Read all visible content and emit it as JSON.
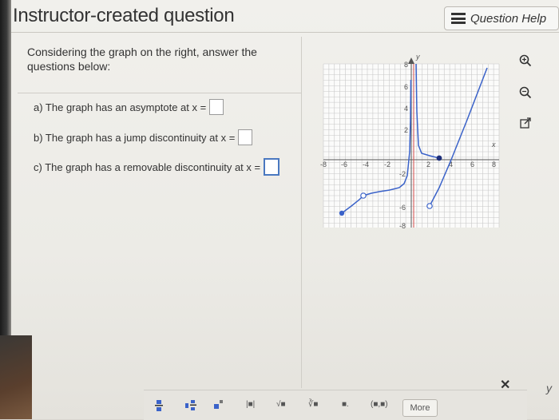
{
  "header": {
    "title": "Instructor-created question",
    "help_label": "Question Help"
  },
  "question": {
    "prompt": "Considering the graph on the right, answer the questions below:",
    "items": [
      {
        "label": "a) The graph has an asymptote at x ="
      },
      {
        "label": "b) The graph has a jump discontinuity at x ="
      },
      {
        "label": "c) The graph has a removable discontinuity at x ="
      }
    ]
  },
  "graph": {
    "axis_x_label": "x",
    "axis_y_label": "y",
    "x_ticks": [
      "-8",
      "-6",
      "-4",
      "-2",
      "2",
      "4",
      "6",
      "8"
    ],
    "y_ticks": [
      "8",
      "6",
      "4",
      "2",
      "-2",
      "-6",
      "-8"
    ],
    "colors": {
      "curve": "#3a62c9",
      "asymptote": "#d64b4b",
      "grid": "#c8c8c8"
    }
  },
  "toolbar": {
    "buttons": [
      "fraction-icon",
      "mixed-number-icon",
      "exponent-icon",
      "absolute-value-icon",
      "sqrt-icon",
      "nth-root-icon",
      "decimal-icon",
      "interval-icon"
    ],
    "labels": [
      "",
      "",
      "",
      "|■|",
      "√■",
      "∛■",
      "■.",
      "(■,■)"
    ],
    "more_label": "More",
    "close_glyph": "✕"
  },
  "corner_glyph": "y"
}
